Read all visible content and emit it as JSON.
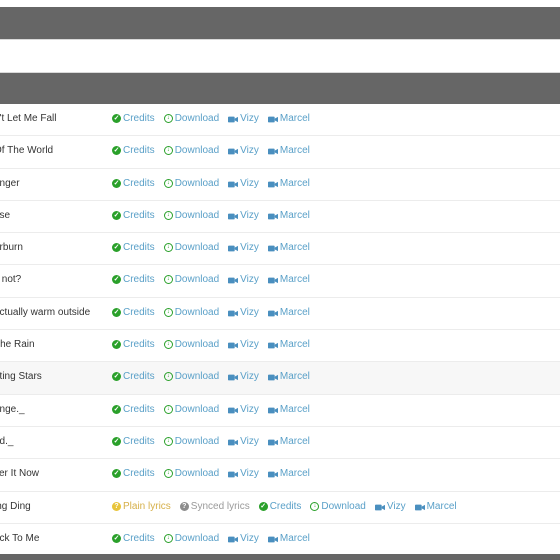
{
  "rows": [
    {
      "title": "n't Let Me Fall"
    },
    {
      "title": "Of The World"
    },
    {
      "title": "onger"
    },
    {
      "title": "pse"
    },
    {
      "title": "erburn"
    },
    {
      "title": "y not?"
    },
    {
      "title": "actually warm outside"
    },
    {
      "title": "The Rain"
    },
    {
      "title": "oting Stars",
      "highlight": true
    },
    {
      "title": "ange._"
    },
    {
      "title": "ed._"
    },
    {
      "title": "ver It Now"
    },
    {
      "title": "ing Ding",
      "extra": true
    },
    {
      "title": "ack To Me"
    }
  ],
  "labels": {
    "credits": "Credits",
    "download": "Download",
    "vizy": "Vizy",
    "marcel": "Marcel",
    "plain_lyrics": "Plain lyrics",
    "synced_lyrics": "Synced lyrics"
  },
  "icons": {
    "credits": "check-circle-icon",
    "download": "download-circle-icon",
    "video": "video-camera-icon",
    "plain": "question-circle-icon",
    "synced": "question-circle-icon"
  }
}
